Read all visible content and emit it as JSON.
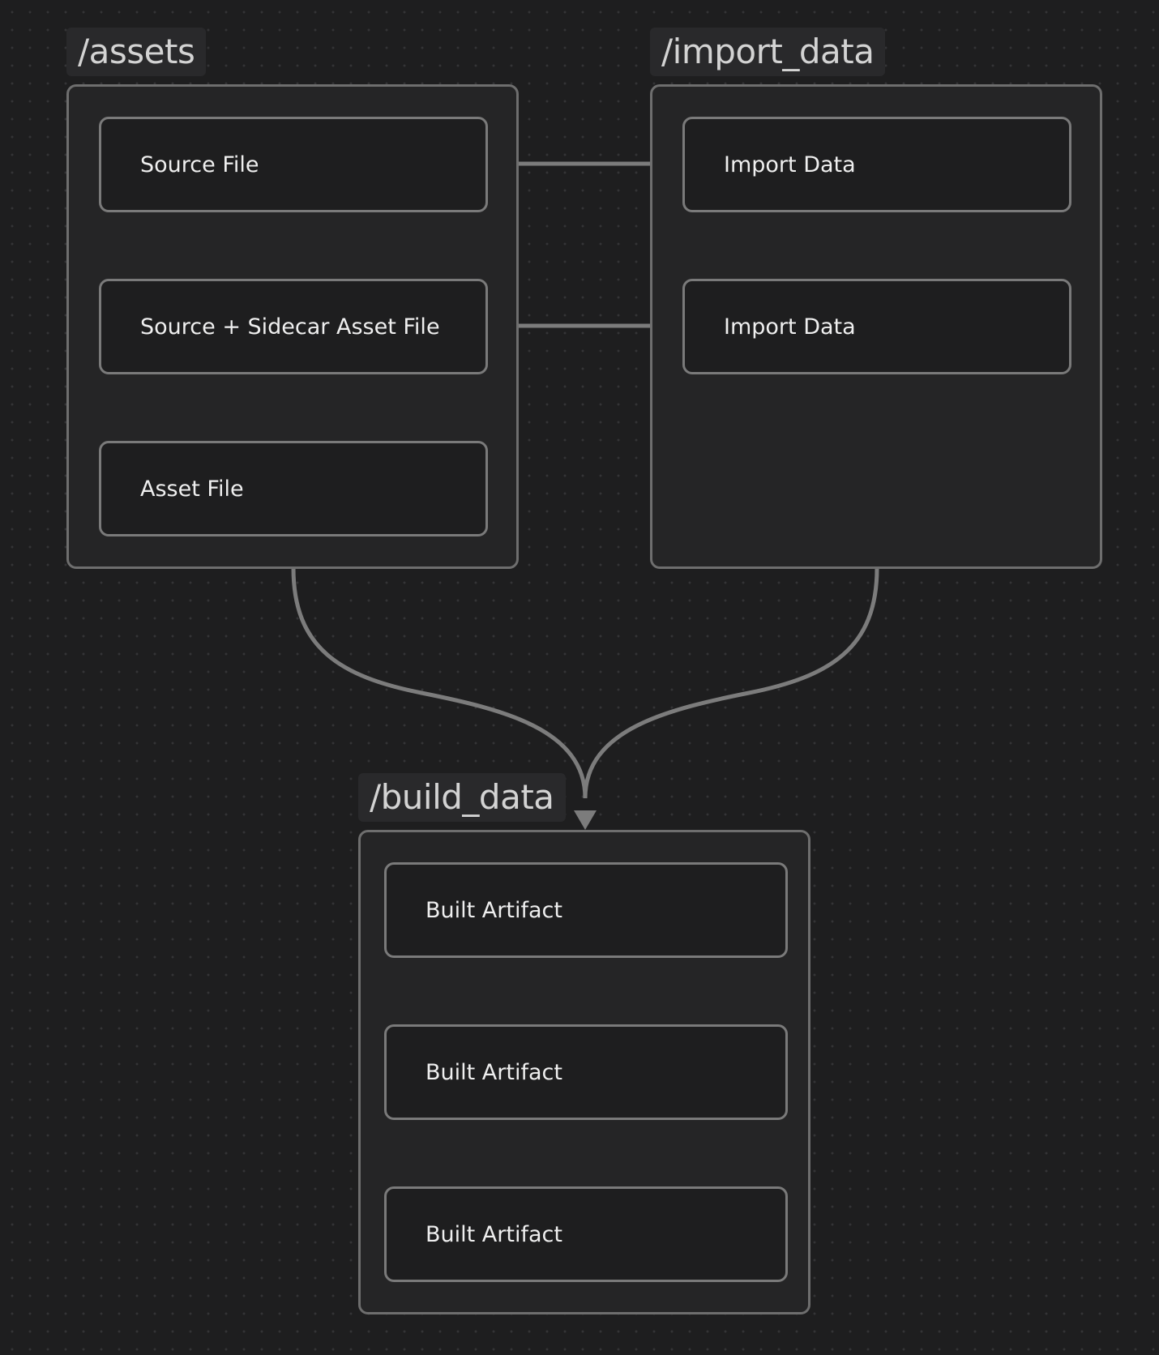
{
  "groups": {
    "assets": {
      "label": "/assets",
      "nodes": [
        "Source File",
        "Source + Sidecar Asset File",
        "Asset File"
      ]
    },
    "import_data": {
      "label": "/import_data",
      "nodes": [
        "Import Data",
        "Import Data"
      ]
    },
    "build_data": {
      "label": "/build_data",
      "nodes": [
        "Built Artifact",
        "Built Artifact",
        "Built Artifact"
      ]
    }
  },
  "edges": [
    {
      "from": "Source File",
      "to": "Import Data"
    },
    {
      "from": "Source + Sidecar Asset File",
      "to": "Import Data"
    },
    {
      "from": "/assets",
      "to": "/build_data"
    },
    {
      "from": "/import_data",
      "to": "/build_data"
    }
  ],
  "colors": {
    "background": "#1e1e1f",
    "group_fill": "#252526",
    "border": "#7a7a7a",
    "connector": "#7c7c7c",
    "text": "#efefef",
    "label_text": "#d3d3d3"
  }
}
